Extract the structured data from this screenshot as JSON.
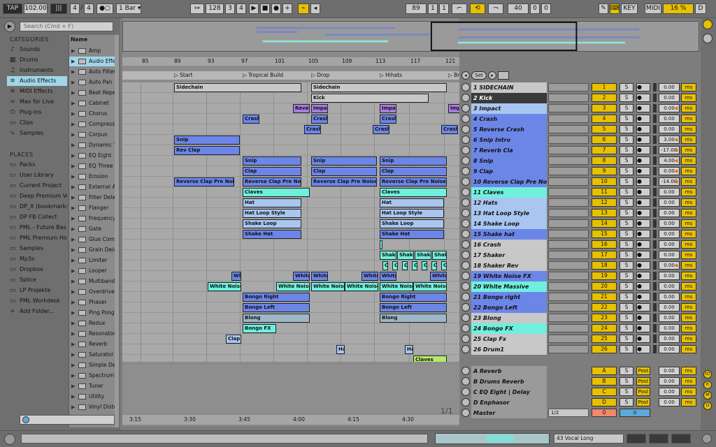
{
  "transport": {
    "tap": "TAP",
    "tempo": "102.00",
    "time_sig_num": "4",
    "time_sig_den": "4",
    "quantize": "1 Bar",
    "pos_bar": "128",
    "pos_beat": "3",
    "pos_sixteenth": "4",
    "loop_bar": "89",
    "loop_beat": "1",
    "loop_sixteenth": "1",
    "len_bar": "40",
    "len_beat": "0",
    "len_sixteenth": "0",
    "key": "KEY",
    "midi": "MIDI",
    "cpu": "16 %",
    "disk": "D"
  },
  "browser": {
    "search_placeholder": "Search (Cmd + F)",
    "categories_title": "CATEGORIES",
    "categories": [
      "Sounds",
      "Drums",
      "Instruments",
      "Audio Effects",
      "MIDI Effects",
      "Max for Live",
      "Plug-ins",
      "Clips",
      "Samples"
    ],
    "places_title": "PLACES",
    "places": [
      "Packs",
      "User Library",
      "Current Project",
      "Deep Premium Vo",
      "DP_X (bookmarks",
      "DP FB Collect",
      "PML - Future Bas",
      "PML Premium Ho",
      "Samples",
      "Mp3s",
      "Dropbox",
      "Splice",
      "LP Projekte",
      "PML Workdesk",
      "Add Folder..."
    ],
    "name_header": "Name",
    "files": [
      "Amp",
      "Audio Effect",
      "Auto Filter",
      "Auto Pan",
      "Beat Repeat",
      "Cabinet",
      "Chorus",
      "Compressor",
      "Corpus",
      "Dynamic Tube",
      "EQ Eight",
      "EQ Three",
      "Erosion",
      "External A",
      "Filter Delay",
      "Flanger",
      "Frequency",
      "Gate",
      "Glue Comp",
      "Grain Delay",
      "Limiter",
      "Looper",
      "Multiband",
      "Overdrive",
      "Phaser",
      "Ping Pong",
      "Redux",
      "Resonators",
      "Reverb",
      "Saturator",
      "Simple Delay",
      "Spectrum",
      "Tuner",
      "Utility",
      "Vinyl Distortion"
    ]
  },
  "ruler": {
    "bars": [
      "85",
      "89",
      "93",
      "97",
      "101",
      "105",
      "109",
      "113",
      "117",
      "121"
    ],
    "times": [
      "3:15",
      "3:30",
      "3:45",
      "4:00",
      "4:15",
      "4:30"
    ]
  },
  "locators": [
    "Start",
    "Tropical Build",
    "Drop",
    "Hihats",
    "Br"
  ],
  "set_label": "Set",
  "page_indicator": "1/1",
  "colors": {
    "cyan": "#6ff0dd",
    "blue": "#6c86e8",
    "lightblue": "#a8c6f0",
    "grey": "#c8c8c8",
    "purple": "#a87ce0",
    "yellow": "#e7c100",
    "steel": "#9db7c8",
    "green": "#b6e86c"
  },
  "clips": [
    {
      "lane": 0,
      "start": 0,
      "end": 182,
      "label": "Sidechain",
      "color": "grey"
    },
    {
      "lane": 0,
      "start": 196,
      "end": 390,
      "label": "Sidechain",
      "color": "grey"
    },
    {
      "lane": 1,
      "start": 196,
      "end": 364,
      "label": "Kick",
      "color": "grey"
    },
    {
      "lane": 2,
      "start": 170,
      "end": 194,
      "label": "Reverse",
      "color": "purple"
    },
    {
      "lane": 2,
      "start": 196,
      "end": 220,
      "label": "Impact",
      "color": "purple"
    },
    {
      "lane": 2,
      "start": 294,
      "end": 318,
      "label": "Impact",
      "color": "purple"
    },
    {
      "lane": 2,
      "start": 392,
      "end": 410,
      "label": "Impact",
      "color": "purple"
    },
    {
      "lane": 3,
      "start": 98,
      "end": 122,
      "label": "Crash",
      "color": "blue"
    },
    {
      "lane": 3,
      "start": 196,
      "end": 220,
      "label": "Crash",
      "color": "blue"
    },
    {
      "lane": 3,
      "start": 294,
      "end": 318,
      "label": "Crash",
      "color": "blue"
    },
    {
      "lane": 4,
      "start": 186,
      "end": 210,
      "label": "Crash",
      "color": "blue"
    },
    {
      "lane": 4,
      "start": 284,
      "end": 308,
      "label": "Crash",
      "color": "blue"
    },
    {
      "lane": 4,
      "start": 382,
      "end": 406,
      "label": "Crash",
      "color": "blue"
    },
    {
      "lane": 5,
      "start": 0,
      "end": 94,
      "label": "Snip",
      "color": "blue"
    },
    {
      "lane": 6,
      "start": 0,
      "end": 94,
      "label": "Rev Clap",
      "color": "blue"
    },
    {
      "lane": 7,
      "start": 98,
      "end": 182,
      "label": "Snip",
      "color": "blue"
    },
    {
      "lane": 7,
      "start": 196,
      "end": 290,
      "label": "Snip",
      "color": "blue"
    },
    {
      "lane": 7,
      "start": 294,
      "end": 390,
      "label": "Snip",
      "color": "blue"
    },
    {
      "lane": 8,
      "start": 98,
      "end": 182,
      "label": "Clap",
      "color": "blue"
    },
    {
      "lane": 8,
      "start": 196,
      "end": 290,
      "label": "Clap",
      "color": "blue"
    },
    {
      "lane": 8,
      "start": 294,
      "end": 390,
      "label": "Clap",
      "color": "blue"
    },
    {
      "lane": 9,
      "start": 0,
      "end": 86,
      "label": "Reverse Clap Pre Noise",
      "color": "blue"
    },
    {
      "lane": 9,
      "start": 98,
      "end": 182,
      "label": "Reverse Clap Pre Noise",
      "color": "blue"
    },
    {
      "lane": 9,
      "start": 196,
      "end": 290,
      "label": "Reverse Clap Pre Noise",
      "color": "blue"
    },
    {
      "lane": 9,
      "start": 294,
      "end": 390,
      "label": "Reverse Clap Pre Noise",
      "color": "blue"
    },
    {
      "lane": 10,
      "start": 98,
      "end": 194,
      "label": "Claves",
      "color": "cyan"
    },
    {
      "lane": 10,
      "start": 294,
      "end": 390,
      "label": "Claves",
      "color": "cyan"
    },
    {
      "lane": 11,
      "start": 98,
      "end": 182,
      "label": "Hat",
      "color": "lightblue"
    },
    {
      "lane": 11,
      "start": 294,
      "end": 386,
      "label": "Hat",
      "color": "lightblue"
    },
    {
      "lane": 12,
      "start": 98,
      "end": 182,
      "label": "Hat Loop Style",
      "color": "lightblue"
    },
    {
      "lane": 12,
      "start": 294,
      "end": 386,
      "label": "Hat Loop Style",
      "color": "lightblue"
    },
    {
      "lane": 13,
      "start": 98,
      "end": 182,
      "label": "Shake Loop",
      "color": "lightblue"
    },
    {
      "lane": 13,
      "start": 294,
      "end": 386,
      "label": "Shake Loop",
      "color": "lightblue"
    },
    {
      "lane": 14,
      "start": 98,
      "end": 182,
      "label": "Shake Hat",
      "color": "blue"
    },
    {
      "lane": 14,
      "start": 294,
      "end": 386,
      "label": "Shake Hat",
      "color": "blue"
    },
    {
      "lane": 15,
      "start": 294,
      "end": 298,
      "label": "C",
      "color": "cyan"
    },
    {
      "lane": 16,
      "start": 294,
      "end": 318,
      "label": "Shake",
      "color": "cyan"
    },
    {
      "lane": 16,
      "start": 319,
      "end": 343,
      "label": "Shake",
      "color": "cyan"
    },
    {
      "lane": 16,
      "start": 344,
      "end": 368,
      "label": "Shake",
      "color": "cyan"
    },
    {
      "lane": 16,
      "start": 369,
      "end": 390,
      "label": "Shake",
      "color": "cyan"
    },
    {
      "lane": 17,
      "start": 298,
      "end": 306,
      "label": "C",
      "color": "cyan"
    },
    {
      "lane": 17,
      "start": 312,
      "end": 320,
      "label": "C",
      "color": "cyan"
    },
    {
      "lane": 17,
      "start": 326,
      "end": 334,
      "label": "C",
      "color": "cyan"
    },
    {
      "lane": 17,
      "start": 340,
      "end": 348,
      "label": "C",
      "color": "cyan"
    },
    {
      "lane": 17,
      "start": 354,
      "end": 362,
      "label": "C",
      "color": "cyan"
    },
    {
      "lane": 17,
      "start": 368,
      "end": 376,
      "label": "C",
      "color": "cyan"
    },
    {
      "lane": 17,
      "start": 382,
      "end": 390,
      "label": "C",
      "color": "cyan"
    },
    {
      "lane": 18,
      "start": 82,
      "end": 96,
      "label": "Wh",
      "color": "blue"
    },
    {
      "lane": 18,
      "start": 170,
      "end": 194,
      "label": "White",
      "color": "blue"
    },
    {
      "lane": 18,
      "start": 196,
      "end": 220,
      "label": "White",
      "color": "blue"
    },
    {
      "lane": 18,
      "start": 268,
      "end": 292,
      "label": "White",
      "color": "blue"
    },
    {
      "lane": 18,
      "start": 294,
      "end": 318,
      "label": "White",
      "color": "blue"
    },
    {
      "lane": 18,
      "start": 366,
      "end": 390,
      "label": "White",
      "color": "blue"
    },
    {
      "lane": 19,
      "start": 48,
      "end": 96,
      "label": "White Noise",
      "color": "cyan"
    },
    {
      "lane": 19,
      "start": 146,
      "end": 194,
      "label": "White Noise",
      "color": "cyan"
    },
    {
      "lane": 19,
      "start": 196,
      "end": 244,
      "label": "White Noise",
      "color": "cyan"
    },
    {
      "lane": 19,
      "start": 244,
      "end": 292,
      "label": "White Noise",
      "color": "cyan"
    },
    {
      "lane": 19,
      "start": 294,
      "end": 342,
      "label": "White Noise",
      "color": "cyan"
    },
    {
      "lane": 19,
      "start": 342,
      "end": 390,
      "label": "White Noise",
      "color": "cyan"
    },
    {
      "lane": 20,
      "start": 98,
      "end": 194,
      "label": "Bongo Right",
      "color": "blue"
    },
    {
      "lane": 20,
      "start": 294,
      "end": 390,
      "label": "Bongo Right",
      "color": "blue"
    },
    {
      "lane": 21,
      "start": 98,
      "end": 194,
      "label": "Bongo Left",
      "color": "blue"
    },
    {
      "lane": 21,
      "start": 294,
      "end": 390,
      "label": "Bongo Left",
      "color": "blue"
    },
    {
      "lane": 22,
      "start": 98,
      "end": 194,
      "label": "Blong",
      "color": "steel"
    },
    {
      "lane": 22,
      "start": 294,
      "end": 390,
      "label": "Blong",
      "color": "steel"
    },
    {
      "lane": 23,
      "start": 98,
      "end": 146,
      "label": "Bongo FX",
      "color": "cyan"
    },
    {
      "lane": 24,
      "start": 74,
      "end": 96,
      "label": "Clap F",
      "color": "lightblue"
    },
    {
      "lane": 25,
      "start": 232,
      "end": 244,
      "label": "Ha",
      "color": "lightblue"
    },
    {
      "lane": 25,
      "start": 330,
      "end": 342,
      "label": "Ha",
      "color": "lightblue"
    },
    {
      "lane": 26,
      "start": 342,
      "end": 390,
      "label": "Claves",
      "color": "green"
    }
  ],
  "tracks": [
    {
      "name": "1 SIDECHAIN",
      "num": "1",
      "vol": "0.00",
      "color": "grey",
      "arm": false
    },
    {
      "name": "2 Kick",
      "num": "2",
      "vol": "0.00",
      "color": "grey",
      "arm": false,
      "selected": true
    },
    {
      "name": "3 Impact",
      "num": "3",
      "vol": "0.00",
      "color": "lightblue",
      "arm": true
    },
    {
      "name": "4 Crash",
      "num": "4",
      "vol": "0.00",
      "color": "blue",
      "arm": false
    },
    {
      "name": "5 Reverse Crash",
      "num": "5",
      "vol": "0.00",
      "color": "blue",
      "arm": false
    },
    {
      "name": "6 Snip Intro",
      "num": "6",
      "vol": "3.00",
      "color": "blue",
      "arm": true
    },
    {
      "name": "7 Reverb Cla",
      "num": "7",
      "vol": "-17.00",
      "color": "blue",
      "arm": true
    },
    {
      "name": "8 Snip",
      "num": "8",
      "vol": "4.00",
      "color": "blue",
      "arm": true
    },
    {
      "name": "9 Clap",
      "num": "9",
      "vol": "0.00",
      "color": "blue",
      "arm": true
    },
    {
      "name": "10 Reverse Clap Pre Noi",
      "num": "10",
      "vol": "-14.00",
      "color": "blue",
      "arm": true
    },
    {
      "name": "11 Claves",
      "num": "11",
      "vol": "0.00",
      "color": "cyan",
      "arm": false
    },
    {
      "name": "12 Hats",
      "num": "12",
      "vol": "0.00",
      "color": "lightblue",
      "arm": false
    },
    {
      "name": "13 Hat Loop Style",
      "num": "13",
      "vol": "0.00",
      "color": "lightblue",
      "arm": false
    },
    {
      "name": "14 Shake Loop",
      "num": "14",
      "vol": "0.00",
      "color": "lightblue",
      "arm": false
    },
    {
      "name": "15 Shake hat",
      "num": "15",
      "vol": "0.00",
      "color": "blue",
      "arm": false
    },
    {
      "name": "16 Crash",
      "num": "16",
      "vol": "0.00",
      "color": "grey",
      "arm": false
    },
    {
      "name": "17 Shaker",
      "num": "17",
      "vol": "0.00",
      "color": "grey",
      "arm": false
    },
    {
      "name": "18 Shaker Rev",
      "num": "18",
      "vol": "0.00",
      "color": "grey",
      "arm": true
    },
    {
      "name": "19 White Noise FX",
      "num": "19",
      "vol": "0.00",
      "color": "blue",
      "arm": false
    },
    {
      "name": "20 White Massive",
      "num": "20",
      "vol": "0.00",
      "color": "cyan",
      "arm": false
    },
    {
      "name": "21 Bongo right",
      "num": "21",
      "vol": "0.00",
      "color": "blue",
      "arm": false
    },
    {
      "name": "22 Bongo Left",
      "num": "22",
      "vol": "0.00",
      "color": "blue",
      "arm": false
    },
    {
      "name": "23 Blong",
      "num": "23",
      "vol": "0.00",
      "color": "grey",
      "arm": false
    },
    {
      "name": "24 Bongo FX",
      "num": "24",
      "vol": "0.00",
      "color": "cyan",
      "arm": false
    },
    {
      "name": "25 Clap Fx",
      "num": "25",
      "vol": "0.00",
      "color": "grey",
      "arm": false
    },
    {
      "name": "26 Drum1",
      "num": "26",
      "vol": "0.00",
      "color": "grey",
      "arm": false
    }
  ],
  "returns": [
    {
      "name": "A Reverb",
      "letter": "A",
      "vol": "0.00",
      "post": "Post"
    },
    {
      "name": "B Drums Reverb",
      "letter": "B",
      "vol": "0.00",
      "post": "Post"
    },
    {
      "name": "C EQ Eight | Delay",
      "letter": "C",
      "vol": "0.00",
      "post": "Post"
    },
    {
      "name": "D Enphasor",
      "letter": "D",
      "vol": "0.00",
      "post": "Post"
    }
  ],
  "master": {
    "name": "Master",
    "num": "0",
    "vol": "0",
    "split": "1/2"
  },
  "side_buttons": [
    "IO",
    "R",
    "M",
    "D"
  ],
  "status": {
    "track_label": "43 Vocal Long"
  },
  "solo_label": "S"
}
